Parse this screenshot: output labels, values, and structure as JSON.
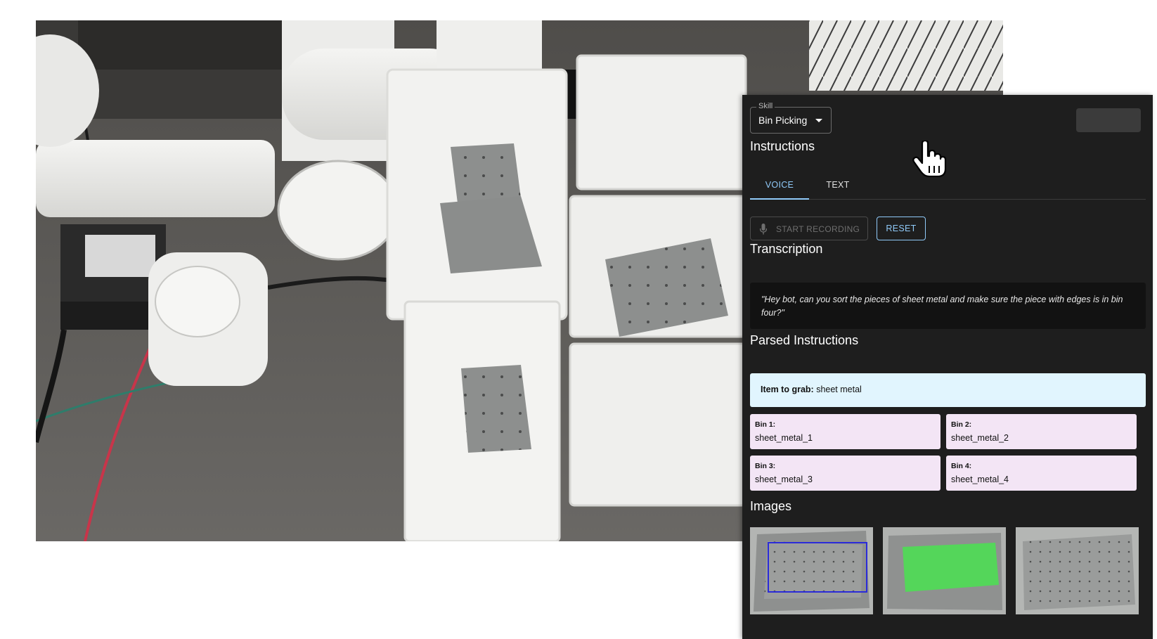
{
  "skill": {
    "legend": "Skill",
    "value": "Bin Picking"
  },
  "sections": {
    "instructions": "Instructions",
    "transcription": "Transcription",
    "parsed_instructions": "Parsed Instructions",
    "images": "Images"
  },
  "tabs": [
    {
      "label": "VOICE",
      "active": true
    },
    {
      "label": "TEXT",
      "active": false
    }
  ],
  "buttons": {
    "start_recording": "START RECORDING",
    "start_recording_disabled": true,
    "reset": "RESET"
  },
  "transcript": "\"Hey bot, can you sort the pieces of sheet metal and make sure the piece with edges is in bin four?\"",
  "parsed": {
    "item_label": "Item to grab:",
    "item_value": "sheet metal",
    "bins": [
      {
        "label": "Bin 1:",
        "value": "sheet_metal_1"
      },
      {
        "label": "Bin 2:",
        "value": "sheet_metal_2"
      },
      {
        "label": "Bin 3:",
        "value": "sheet_metal_3"
      },
      {
        "label": "Bin 4:",
        "value": "sheet_metal_4"
      }
    ]
  },
  "images": [
    {
      "overlay": "bounding-box",
      "overlay_color": "#2b2bd9"
    },
    {
      "overlay": "segmentation-mask",
      "overlay_color": "#54d65a"
    },
    {
      "overlay": "none"
    }
  ],
  "icons": {
    "skill_dropdown": "chevron-down-icon",
    "record": "microphone-icon",
    "cursor": "hand-pointer-icon"
  },
  "colors": {
    "panel_bg": "#1e1e1e",
    "accent": "#90caf9",
    "item_box": "#e1f5fe",
    "bin_box": "#f3e5f5"
  }
}
